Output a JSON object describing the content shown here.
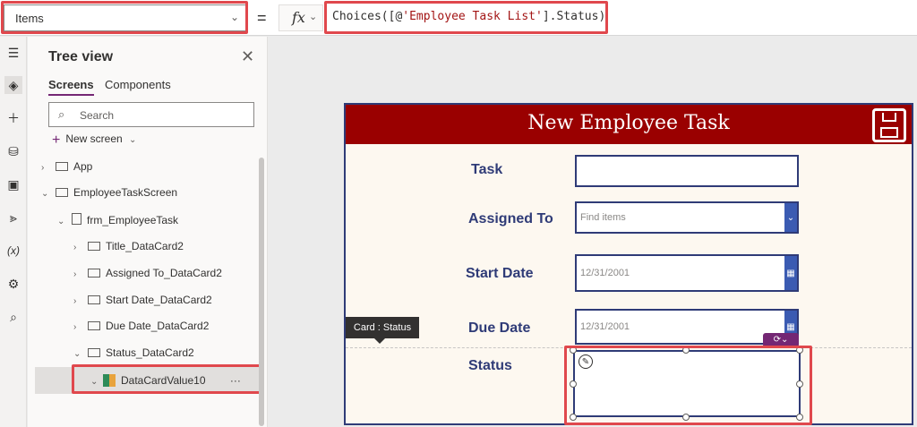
{
  "formula_bar": {
    "property": "Items",
    "equals": "=",
    "fx_label": "fx",
    "formula_prefix": "Choices([@",
    "formula_string": "'Employee Task List'",
    "formula_suffix": "].Status)"
  },
  "tree_view": {
    "title": "Tree view",
    "tabs": [
      "Screens",
      "Components"
    ],
    "search_placeholder": "Search",
    "new_screen": "New screen",
    "nodes": {
      "app": "App",
      "screen": "EmployeeTaskScreen",
      "form": "frm_EmployeeTask",
      "card1": "Title_DataCard2",
      "card2": "Assigned To_DataCard2",
      "card3": "Start Date_DataCard2",
      "card4": "Due Date_DataCard2",
      "card5": "Status_DataCard2",
      "selected": "DataCardValue10",
      "more": "···"
    }
  },
  "canvas": {
    "header_title": "New Employee Task",
    "fields": {
      "task": "Task",
      "assigned_to": "Assigned To",
      "start_date": "Start Date",
      "due_date": "Due Date",
      "status": "Status"
    },
    "assigned_placeholder": "Find items",
    "start_date_value": "12/31/2001",
    "due_date_value": "12/31/2001",
    "tooltip": "Card : Status"
  },
  "colors": {
    "header": "#9a0000",
    "accent": "#2f3b77",
    "highlight": "#e0484d"
  }
}
